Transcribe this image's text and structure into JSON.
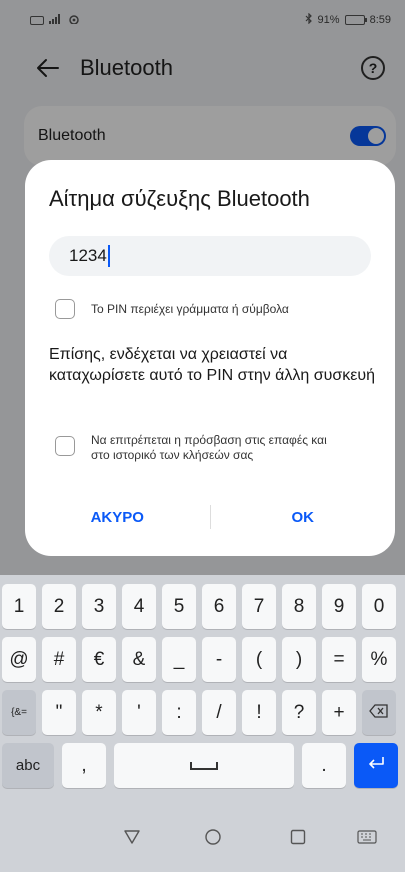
{
  "status_bar": {
    "battery": "91%",
    "time": "8:59"
  },
  "header": {
    "title": "Bluetooth"
  },
  "bluetooth_row": {
    "label": "Bluetooth",
    "enabled": true
  },
  "dialog": {
    "title": "Αίτημα σύζευξης Bluetooth",
    "pin_value": "1234",
    "pin_checkbox_label": "Το PIN περιέχει γράμματα ή σύμβολα",
    "info_text": "Επίσης, ενδέχεται να χρειαστεί να καταχωρίσετε αυτό το PIN στην άλλη συσκευή",
    "contacts_checkbox_label": "Να επιτρέπεται η πρόσβαση στις επαφές και στο ιστορικό των κλήσεών σας",
    "cancel_label": "ΑΚΥΡΟ",
    "ok_label": "OK"
  },
  "keyboard": {
    "row1": [
      "1",
      "2",
      "3",
      "4",
      "5",
      "6",
      "7",
      "8",
      "9",
      "0"
    ],
    "row2": [
      "@",
      "#",
      "€",
      "&",
      "_",
      "-",
      "(",
      ")",
      "=",
      "%"
    ],
    "row3": [
      "{&=",
      "\"",
      "*",
      "'",
      ":",
      "/",
      "!",
      "?",
      "+"
    ],
    "abc_label": "abc",
    "comma_label": ",",
    "period_label": "."
  },
  "colors": {
    "accent": "#0a59f7",
    "background": "#f1f3f5",
    "keyboard": "#cfd2d7"
  }
}
